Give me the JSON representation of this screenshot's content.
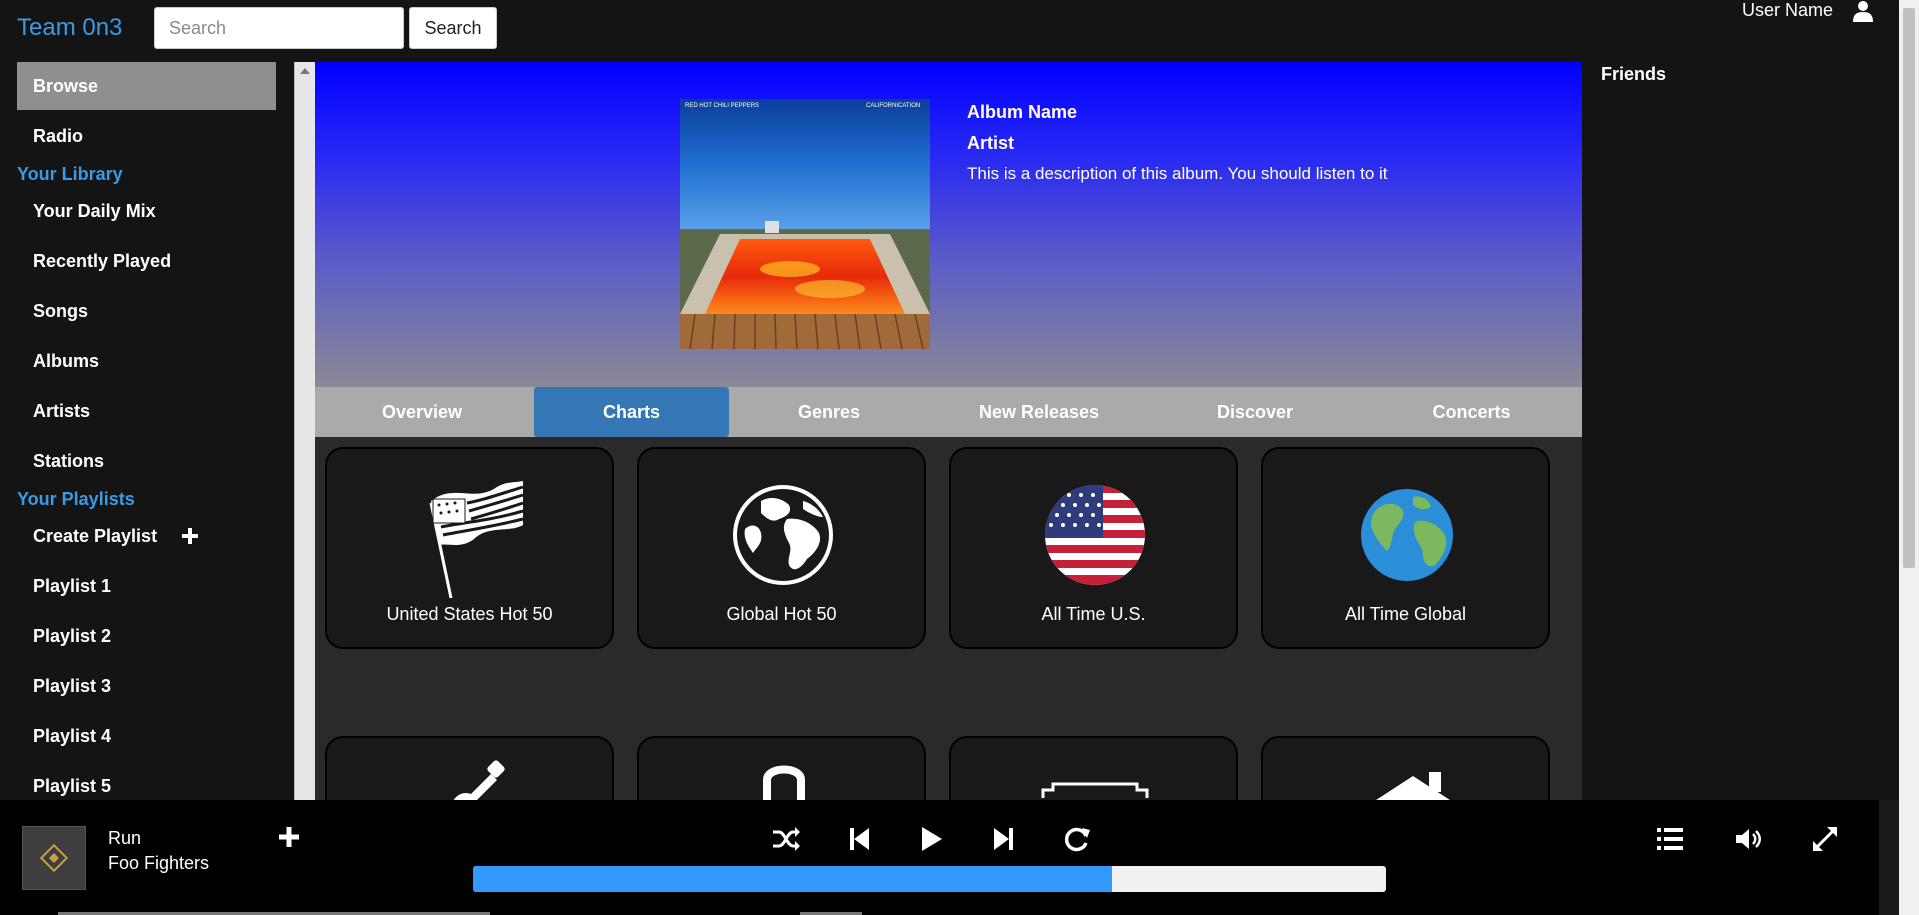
{
  "header": {
    "brand": "Team 0n3",
    "search_placeholder": "Search",
    "search_button": "Search",
    "username": "User Name"
  },
  "sidebar": {
    "browse": "Browse",
    "radio": "Radio",
    "library_heading": "Your Library",
    "library": [
      "Your Daily Mix",
      "Recently Played",
      "Songs",
      "Albums",
      "Artists",
      "Stations"
    ],
    "playlists_heading": "Your Playlists",
    "create_playlist": "Create Playlist",
    "playlists": [
      "Playlist 1",
      "Playlist 2",
      "Playlist 3",
      "Playlist 4",
      "Playlist 5"
    ]
  },
  "album": {
    "name": "Album Name",
    "artist": "Artist",
    "description": "This is a description of this album. You should listen to it",
    "cover_band_text": "RED HOT CHILI PEPPERS",
    "cover_title_text": "CALIFORNICATION"
  },
  "tabs": [
    {
      "label": "Overview",
      "active": false
    },
    {
      "label": "Charts",
      "active": true
    },
    {
      "label": "Genres",
      "active": false
    },
    {
      "label": "New Releases",
      "active": false
    },
    {
      "label": "Discover",
      "active": false
    },
    {
      "label": "Concerts",
      "active": false
    }
  ],
  "charts": [
    {
      "label": "United States Hot 50",
      "icon": "us-flag-waving-icon"
    },
    {
      "label": "Global Hot 50",
      "icon": "globe-icon"
    },
    {
      "label": "All Time U.S.",
      "icon": "us-flag-circle-icon"
    },
    {
      "label": "All Time Global",
      "icon": "earth-icon"
    }
  ],
  "genre_icons": [
    "guitar-icon",
    "headphones-icon",
    "boombox-icon",
    "house-icon"
  ],
  "friends": {
    "title": "Friends"
  },
  "player": {
    "title": "Run",
    "artist": "Foo Fighters",
    "progress": 0.7
  },
  "colors": {
    "accent": "#3a9ae6",
    "active_tab": "#3577b5",
    "progress_fill": "#3399ff"
  }
}
